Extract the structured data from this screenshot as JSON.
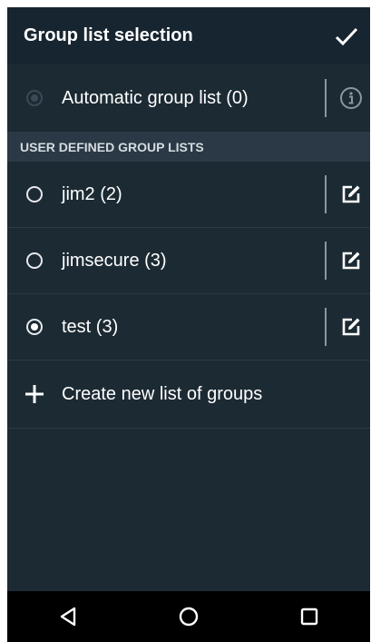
{
  "header": {
    "title": "Group list selection",
    "confirm_icon": "check-icon"
  },
  "automatic": {
    "label": "Automatic group list (0)",
    "selected": false,
    "enabled": false,
    "info_icon": "info-icon"
  },
  "section": {
    "title": "USER DEFINED GROUP LISTS"
  },
  "group_lists": [
    {
      "label": "jim2 (2)",
      "selected": false,
      "edit_icon": "edit-icon"
    },
    {
      "label": "jimsecure (3)",
      "selected": false,
      "edit_icon": "edit-icon"
    },
    {
      "label": "test (3)",
      "selected": true,
      "edit_icon": "edit-icon"
    }
  ],
  "create": {
    "label": "Create new list of groups",
    "icon": "plus-icon"
  },
  "navbar": {
    "back_icon": "back-triangle-icon",
    "home_icon": "home-circle-icon",
    "recents_icon": "recents-square-icon"
  },
  "colors": {
    "background": "#1c2a33",
    "appbar": "#172530",
    "section_header": "#2a3945",
    "text": "#ffffff",
    "navbar": "#000000"
  }
}
